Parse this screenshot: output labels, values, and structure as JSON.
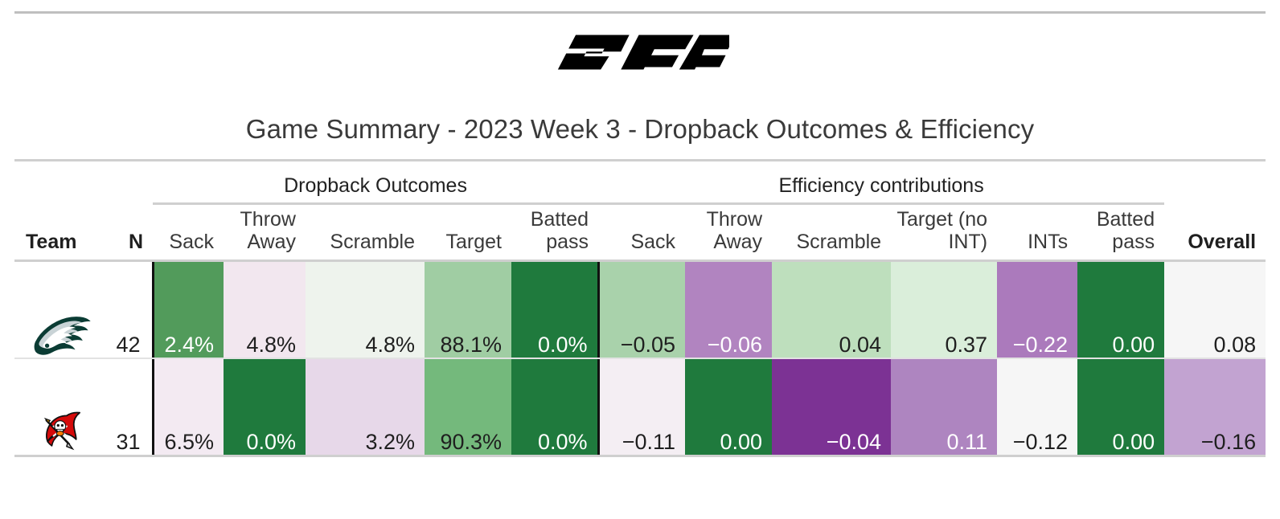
{
  "brand": {
    "logo_text": "PFF",
    "logo_name": "pff-logo"
  },
  "title": "Game Summary - 2023 Week 3 - Dropback Outcomes & Efficiency",
  "groups": [
    {
      "label": "",
      "span": 2
    },
    {
      "label": "Dropback Outcomes",
      "span": 5
    },
    {
      "label": "Efficiency contributions",
      "span": 6
    },
    {
      "label": "",
      "span": 1
    }
  ],
  "columns": [
    {
      "key": "team",
      "label": "Team",
      "bold": true
    },
    {
      "key": "n",
      "label": "N",
      "bold": true
    },
    {
      "key": "sack_pct",
      "label": "Sack",
      "bold": false
    },
    {
      "key": "throw_away_pct",
      "label": "Throw Away",
      "bold": false
    },
    {
      "key": "scramble_pct",
      "label": "Scramble",
      "bold": false
    },
    {
      "key": "target_pct",
      "label": "Target",
      "bold": false
    },
    {
      "key": "batted_pct",
      "label": "Batted pass",
      "bold": false
    },
    {
      "key": "sack_eff",
      "label": "Sack",
      "bold": false
    },
    {
      "key": "throw_away_eff",
      "label": "Throw Away",
      "bold": false
    },
    {
      "key": "scramble_eff",
      "label": "Scramble",
      "bold": false
    },
    {
      "key": "target_eff",
      "label": "Target (no INT)",
      "bold": false
    },
    {
      "key": "ints_eff",
      "label": "INTs",
      "bold": false
    },
    {
      "key": "batted_eff",
      "label": "Batted pass",
      "bold": false
    },
    {
      "key": "overall",
      "label": "Overall",
      "bold": true
    }
  ],
  "rows": [
    {
      "team_name": "Philadelphia Eagles",
      "team_icon": "eagles-logo-icon",
      "n": "42",
      "cells": [
        {
          "value": "2.4%",
          "bg": "#529b5b",
          "fg": "#ffffff"
        },
        {
          "value": "4.8%",
          "bg": "#f2e7ef",
          "fg": "#1f1f1f"
        },
        {
          "value": "4.8%",
          "bg": "#eef3ed",
          "fg": "#1f1f1f"
        },
        {
          "value": "88.1%",
          "bg": "#a0cda3",
          "fg": "#1f1f1f"
        },
        {
          "value": "0.0%",
          "bg": "#1f7a3d",
          "fg": "#ffffff"
        },
        {
          "value": "−0.05",
          "bg": "#a9d2ab",
          "fg": "#1f1f1f"
        },
        {
          "value": "−0.06",
          "bg": "#b184c0",
          "fg": "#ffffff"
        },
        {
          "value": "0.04",
          "bg": "#bedfbd",
          "fg": "#1f1f1f"
        },
        {
          "value": "0.37",
          "bg": "#daeeda",
          "fg": "#1f1f1f"
        },
        {
          "value": "−0.22",
          "bg": "#ab7 abc",
          "fg": "#ffffff"
        },
        {
          "value": "0.00",
          "bg": "#1f7a3d",
          "fg": "#ffffff"
        },
        {
          "value": "0.08",
          "bg": "#f6f6f6",
          "fg": "#1f1f1f"
        }
      ]
    },
    {
      "team_name": "Tampa Bay Buccaneers",
      "team_icon": "buccaneers-logo-icon",
      "n": "31",
      "cells": [
        {
          "value": "6.5%",
          "bg": "#f3eaf2",
          "fg": "#1f1f1f"
        },
        {
          "value": "0.0%",
          "bg": "#1f7a3d",
          "fg": "#ffffff"
        },
        {
          "value": "3.2%",
          "bg": "#e7d8e9",
          "fg": "#1f1f1f"
        },
        {
          "value": "90.3%",
          "bg": "#74b97c",
          "fg": "#1f1f1f"
        },
        {
          "value": "0.0%",
          "bg": "#1f7a3d",
          "fg": "#ffffff"
        },
        {
          "value": "−0.11",
          "bg": "#f4eef3",
          "fg": "#1f1f1f"
        },
        {
          "value": "0.00",
          "bg": "#1f7a3d",
          "fg": "#ffffff"
        },
        {
          "value": "−0.04",
          "bg": "#7c3294",
          "fg": "#ffffff"
        },
        {
          "value": "0.11",
          "bg": "#ae85c0",
          "fg": "#ffffff"
        },
        {
          "value": "−0.12",
          "bg": "#f6f6f6",
          "fg": "#1f1f1f"
        },
        {
          "value": "0.00",
          "bg": "#1f7a3d",
          "fg": "#ffffff"
        },
        {
          "value": "−0.16",
          "bg": "#c2a3d1",
          "fg": "#1f1f1f"
        }
      ]
    }
  ],
  "chart_data": {
    "type": "table",
    "title": "Game Summary - 2023 Week 3 - Dropback Outcomes & Efficiency",
    "column_groups": [
      "Dropback Outcomes",
      "Efficiency contributions"
    ],
    "columns": [
      "Team",
      "N",
      "Sack",
      "Throw Away",
      "Scramble",
      "Target",
      "Batted pass",
      "Sack",
      "Throw Away",
      "Scramble",
      "Target (no INT)",
      "INTs",
      "Batted pass",
      "Overall"
    ],
    "rows": [
      [
        "Philadelphia Eagles",
        "42",
        "2.4%",
        "4.8%",
        "4.8%",
        "88.1%",
        "0.0%",
        "−0.05",
        "−0.06",
        "0.04",
        "0.37",
        "−0.22",
        "0.00",
        "0.08"
      ],
      [
        "Tampa Bay Buccaneers",
        "31",
        "6.5%",
        "0.0%",
        "3.2%",
        "90.3%",
        "0.0%",
        "−0.11",
        "0.00",
        "−0.04",
        "0.11",
        "−0.12",
        "0.00",
        "−0.16"
      ]
    ],
    "colorscale": {
      "positive": "#1f7a3d",
      "negative": "#7c3294",
      "neutral": "#f6f6f6"
    }
  }
}
